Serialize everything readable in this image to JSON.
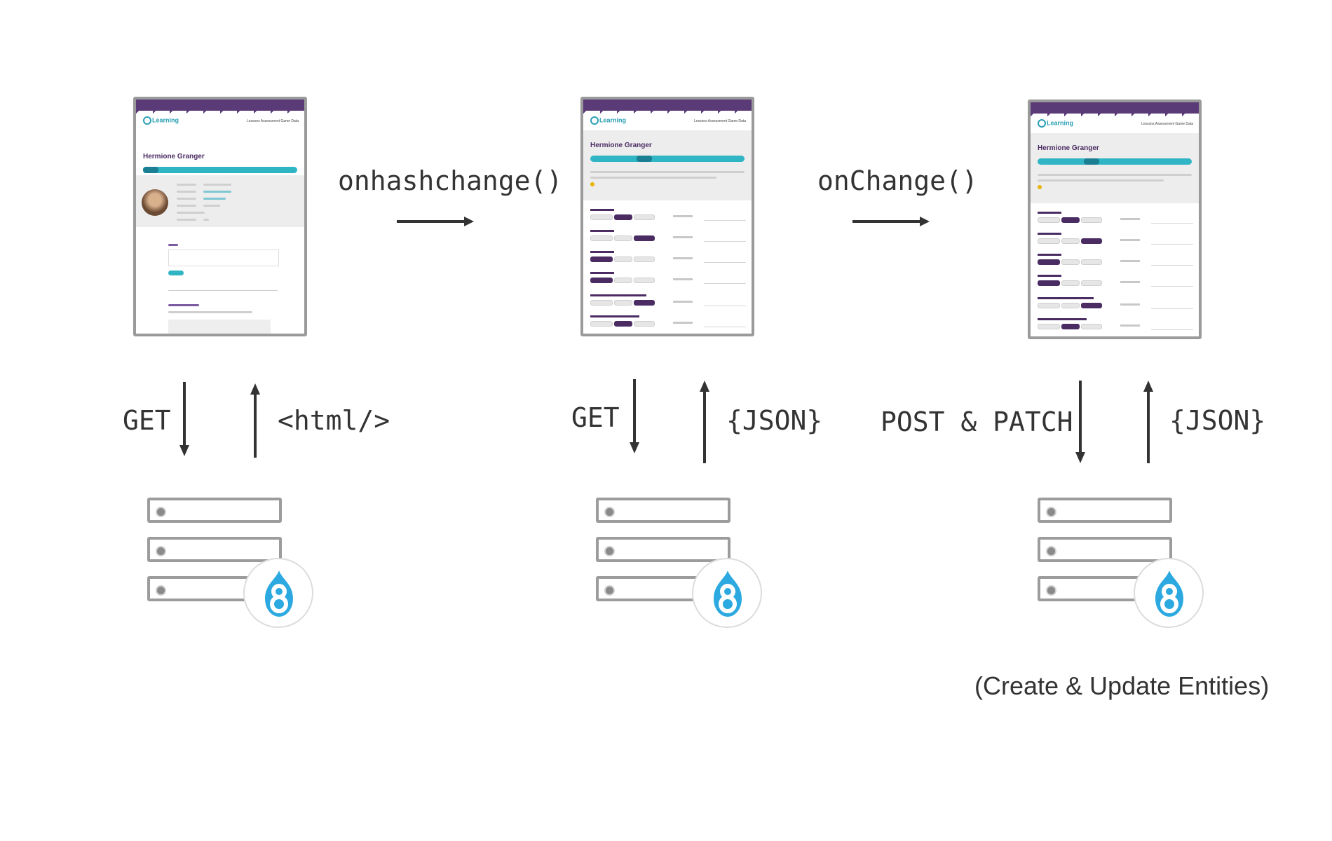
{
  "stages": [
    {
      "screen": {
        "name": "Hermione Granger",
        "nav": "Lessons   Assessment   Game Data"
      },
      "request": "GET",
      "response": "<html/>"
    },
    {
      "screen": {
        "name": "Hermione Granger",
        "nav": "Lessons   Assessment   Game Data"
      },
      "request": "GET",
      "response": "{JSON}"
    },
    {
      "screen": {
        "name": "Hermione Granger",
        "nav": "Lessons   Assessment   Game Data"
      },
      "request": "POST & PATCH",
      "response": "{JSON}"
    }
  ],
  "transitions": [
    "onhashchange()",
    "onChange()"
  ],
  "caption": "(Create & Update Entities)",
  "logo_text": "Learning",
  "colors": {
    "text": "#333333",
    "server_border": "#9c9c9c",
    "drupal_blue": "#2ba9e0",
    "brand_purple": "#4a2c63",
    "tab_teal": "#2fb5c4"
  }
}
